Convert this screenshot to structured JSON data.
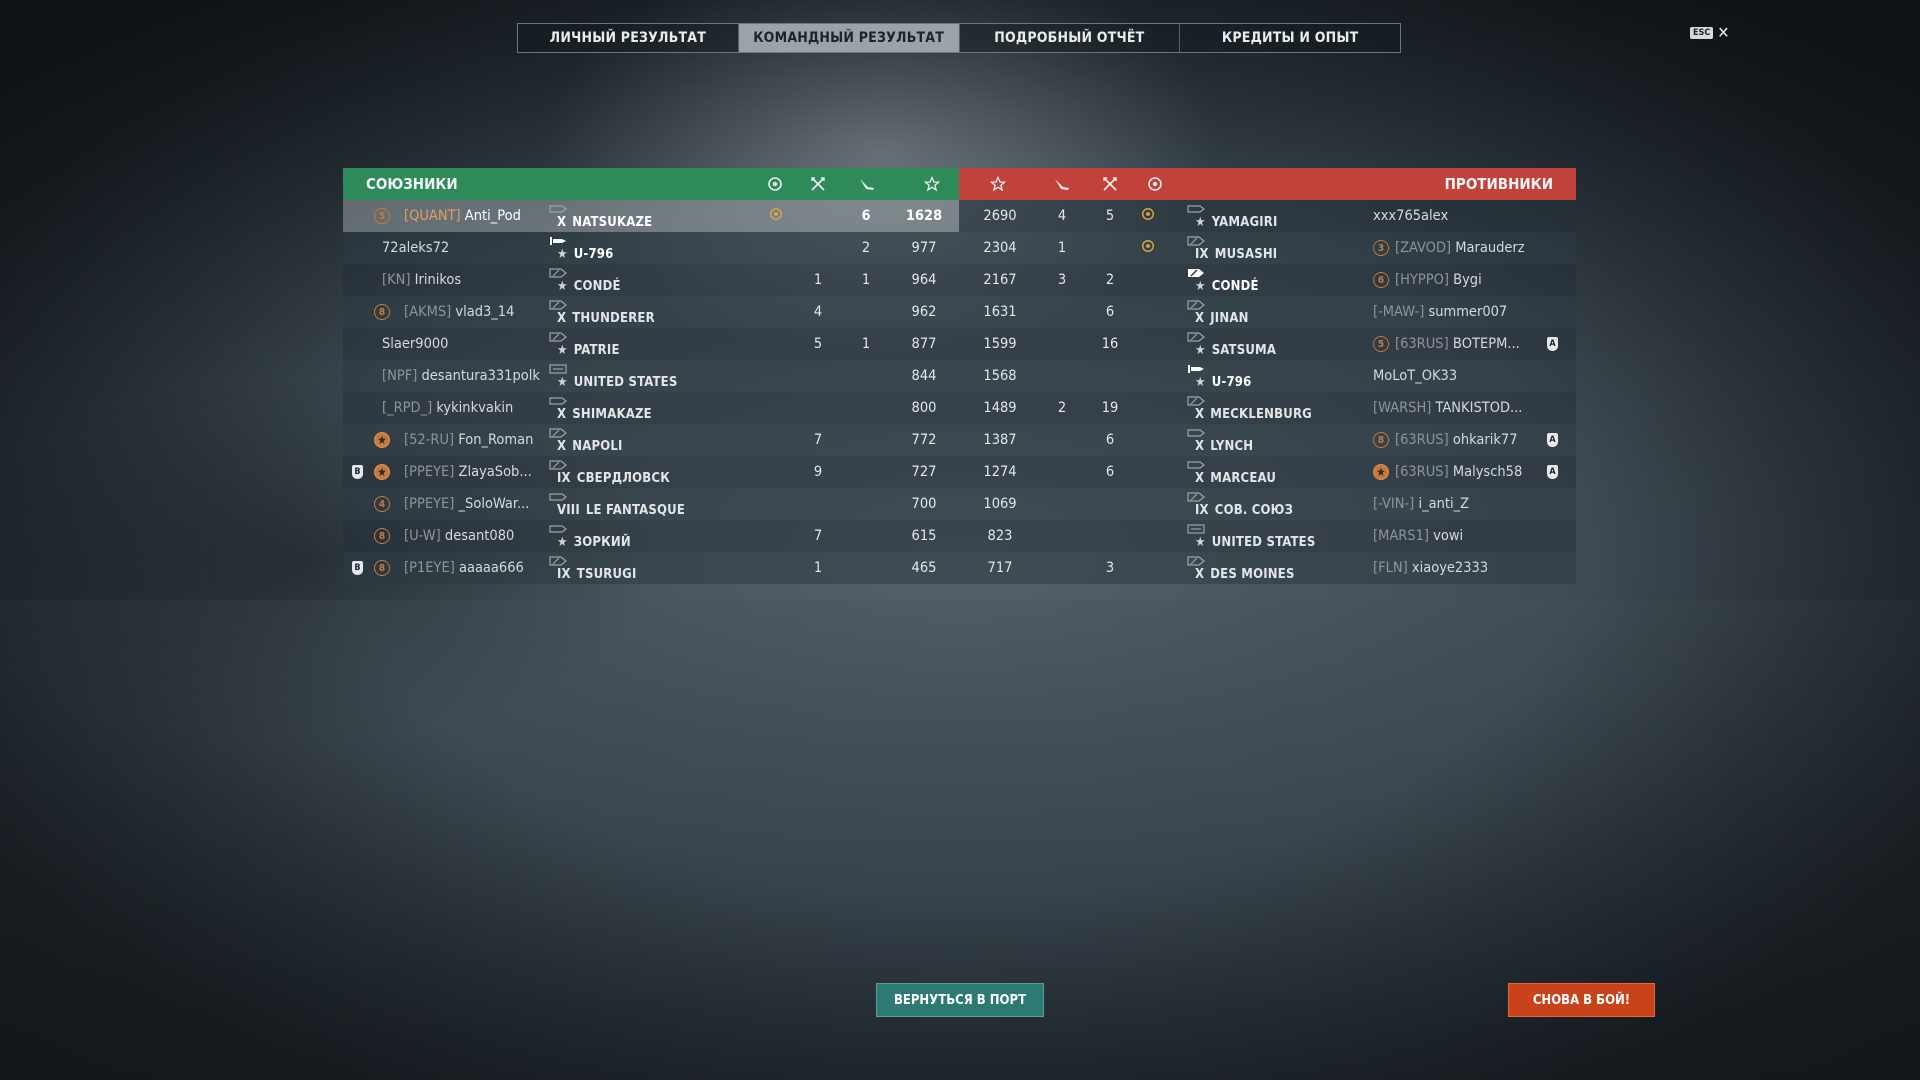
{
  "tabs": [
    {
      "label": "ЛИЧНЫЙ РЕЗУЛЬТАТ"
    },
    {
      "label": "КОМАНДНЫЙ РЕЗУЛЬТАТ"
    },
    {
      "label": "ПОДРОБНЫЙ ОТЧЁТ"
    },
    {
      "label": "КРЕДИТЫ И ОПЫТ"
    }
  ],
  "active_tab": 1,
  "esc_label": "ESC",
  "allies": {
    "title": "СОЮЗНИКИ",
    "column_icons": [
      "commander-skill-icon",
      "frags-icon",
      "planes-destroyed-icon",
      "experience-star-icon"
    ],
    "rows": [
      {
        "badge": "",
        "rank": "5",
        "clan": "[QUANT]",
        "player": "Anti_Pod",
        "ship_icon": "destroyer-icon",
        "tier": "X",
        "premium": false,
        "ship": "NATSUKAZE",
        "skill": true,
        "frags": "",
        "planes": "6",
        "xp": "1628",
        "self": true
      },
      {
        "badge": "",
        "rank": "",
        "clan": "",
        "player": "72aleks72",
        "ship_icon": "submarine-icon",
        "tier": "",
        "premium": true,
        "ship": "U-796",
        "skill": false,
        "frags": "",
        "planes": "2",
        "xp": "977",
        "self": false
      },
      {
        "badge": "",
        "rank": "",
        "clan": "[KN]",
        "player": "Irinikos",
        "ship_icon": "cruiser-icon",
        "tier": "",
        "premium": true,
        "ship": "CONDÉ",
        "skill": false,
        "frags": "1",
        "planes": "1",
        "xp": "964",
        "self": false
      },
      {
        "badge": "",
        "rank": "8",
        "clan": "[AKMS]",
        "player": "vlad3_14",
        "ship_icon": "cruiser-icon",
        "tier": "X",
        "premium": false,
        "ship": "THUNDERER",
        "skill": false,
        "frags": "4",
        "planes": "",
        "xp": "962",
        "self": false
      },
      {
        "badge": "",
        "rank": "",
        "clan": "",
        "player": "Slaer9000",
        "ship_icon": "cruiser-icon",
        "tier": "",
        "premium": true,
        "ship": "PATRIE",
        "skill": false,
        "frags": "5",
        "planes": "1",
        "xp": "877",
        "self": false
      },
      {
        "badge": "",
        "rank": "",
        "clan": "[NPF]",
        "player": "desantura331polk",
        "ship_icon": "carrier-icon",
        "tier": "",
        "premium": true,
        "ship": "UNITED STATES",
        "skill": false,
        "frags": "",
        "planes": "",
        "xp": "844",
        "self": false
      },
      {
        "badge": "",
        "rank": "",
        "clan": "[_RPD_]",
        "player": "kykinkvakin",
        "ship_icon": "destroyer-icon",
        "tier": "X",
        "premium": false,
        "ship": "SHIMAKAZE",
        "skill": false,
        "frags": "",
        "planes": "",
        "xp": "800",
        "self": false
      },
      {
        "badge": "",
        "rank": "★",
        "clan": "[52-RU]",
        "player": "Fon_Roman",
        "ship_icon": "cruiser-icon",
        "tier": "X",
        "premium": false,
        "ship": "NAPOLI",
        "skill": false,
        "frags": "7",
        "planes": "",
        "xp": "772",
        "self": false
      },
      {
        "badge": "B",
        "rank": "★",
        "clan": "[PPEYE]",
        "player": "ZlayaSob...",
        "ship_icon": "cruiser-icon",
        "tier": "IX",
        "premium": false,
        "ship": "СВЕРДЛОВСК",
        "skill": false,
        "frags": "9",
        "planes": "",
        "xp": "727",
        "self": false
      },
      {
        "badge": "",
        "rank": "4",
        "clan": "[PPEYE]",
        "player": "_SoloWar...",
        "ship_icon": "destroyer-icon",
        "tier": "VIII",
        "premium": false,
        "ship": "LE FANTASQUE",
        "skill": false,
        "frags": "",
        "planes": "",
        "xp": "700",
        "self": false
      },
      {
        "badge": "",
        "rank": "8",
        "clan": "[U-W]",
        "player": "desant080",
        "ship_icon": "destroyer-icon",
        "tier": "",
        "premium": true,
        "ship": "ЗОРКИЙ",
        "skill": false,
        "frags": "7",
        "planes": "",
        "xp": "615",
        "self": false
      },
      {
        "badge": "B",
        "rank": "8",
        "clan": "[P1EYE]",
        "player": "aaaaa666",
        "ship_icon": "cruiser-icon",
        "tier": "IX",
        "premium": false,
        "ship": "TSURUGI",
        "skill": false,
        "frags": "1",
        "planes": "",
        "xp": "465",
        "self": false
      }
    ]
  },
  "enemies": {
    "title": "ПРОТИВНИКИ",
    "column_icons": [
      "experience-star-icon",
      "planes-destroyed-icon",
      "frags-icon",
      "commander-skill-icon"
    ],
    "rows": [
      {
        "xp": "2690",
        "planes": "4",
        "frags": "5",
        "skill": true,
        "ship_icon": "destroyer-icon",
        "tier": "",
        "premium": true,
        "ship": "YAMAGIRI",
        "rank": "",
        "clan": "",
        "player": "xxx765alex",
        "badge": ""
      },
      {
        "xp": "2304",
        "planes": "1",
        "frags": "",
        "skill": true,
        "ship_icon": "cruiser-icon",
        "tier": "IX",
        "premium": false,
        "ship": "MUSASHI",
        "rank": "3",
        "clan": "[ZAVOD]",
        "player": "Marauderz",
        "badge": ""
      },
      {
        "xp": "2167",
        "planes": "3",
        "frags": "2",
        "skill": false,
        "ship_icon": "cruiser-bright-icon",
        "tier": "",
        "premium": true,
        "ship": "CONDÉ",
        "rank": "6",
        "clan": "[HYPPO]",
        "player": "Bygi",
        "badge": ""
      },
      {
        "xp": "1631",
        "planes": "",
        "frags": "6",
        "skill": false,
        "ship_icon": "cruiser-icon",
        "tier": "X",
        "premium": false,
        "ship": "JINAN",
        "rank": "",
        "clan": "[-MAW-]",
        "player": "summer007",
        "badge": ""
      },
      {
        "xp": "1599",
        "planes": "",
        "frags": "16",
        "skill": false,
        "ship_icon": "cruiser-icon",
        "tier": "",
        "premium": true,
        "ship": "SATSUMA",
        "rank": "5",
        "clan": "[63RUS]",
        "player": "ВОТЕРМ...",
        "badge": "A"
      },
      {
        "xp": "1568",
        "planes": "",
        "frags": "",
        "skill": false,
        "ship_icon": "submarine-icon",
        "tier": "",
        "premium": true,
        "ship": "U-796",
        "rank": "",
        "clan": "",
        "player": "MoLoT_OK33",
        "badge": ""
      },
      {
        "xp": "1489",
        "planes": "2",
        "frags": "19",
        "skill": false,
        "ship_icon": "cruiser-icon",
        "tier": "X",
        "premium": false,
        "ship": "MECKLENBURG",
        "rank": "",
        "clan": "[WARSH]",
        "player": "TANKISTOD...",
        "badge": ""
      },
      {
        "xp": "1387",
        "planes": "",
        "frags": "6",
        "skill": false,
        "ship_icon": "destroyer-icon",
        "tier": "X",
        "premium": false,
        "ship": "LYNCH",
        "rank": "8",
        "clan": "[63RUS]",
        "player": "ohkarik77",
        "badge": "A"
      },
      {
        "xp": "1274",
        "planes": "",
        "frags": "6",
        "skill": false,
        "ship_icon": "destroyer-icon",
        "tier": "X",
        "premium": false,
        "ship": "MARCEAU",
        "rank": "★",
        "clan": "[63RUS]",
        "player": "Malysch58",
        "badge": "A"
      },
      {
        "xp": "1069",
        "planes": "",
        "frags": "",
        "skill": false,
        "ship_icon": "cruiser-icon",
        "tier": "IX",
        "premium": false,
        "ship": "СОВ. СОЮЗ",
        "rank": "",
        "clan": "[-VIN-]",
        "player": "i_anti_Z",
        "badge": ""
      },
      {
        "xp": "823",
        "planes": "",
        "frags": "",
        "skill": false,
        "ship_icon": "carrier-icon",
        "tier": "",
        "premium": true,
        "ship": "UNITED STATES",
        "rank": "",
        "clan": "[MARS1]",
        "player": "vowi",
        "badge": ""
      },
      {
        "xp": "717",
        "planes": "",
        "frags": "3",
        "skill": false,
        "ship_icon": "cruiser-icon",
        "tier": "X",
        "premium": false,
        "ship": "DES MOINES",
        "rank": "",
        "clan": "[FLN]",
        "player": "xiaoye2333",
        "badge": ""
      }
    ]
  },
  "buttons": {
    "return_port": "ВЕРНУТЬСЯ В ПОРТ",
    "battle_again": "СНОВА В БОЙ!"
  },
  "colors": {
    "ally_header": "#2f8a5a",
    "enemy_header": "#c0423a",
    "accent_rank": "#c77a3e",
    "port_button": "#2d7a73",
    "battle_button": "#c8421a"
  }
}
